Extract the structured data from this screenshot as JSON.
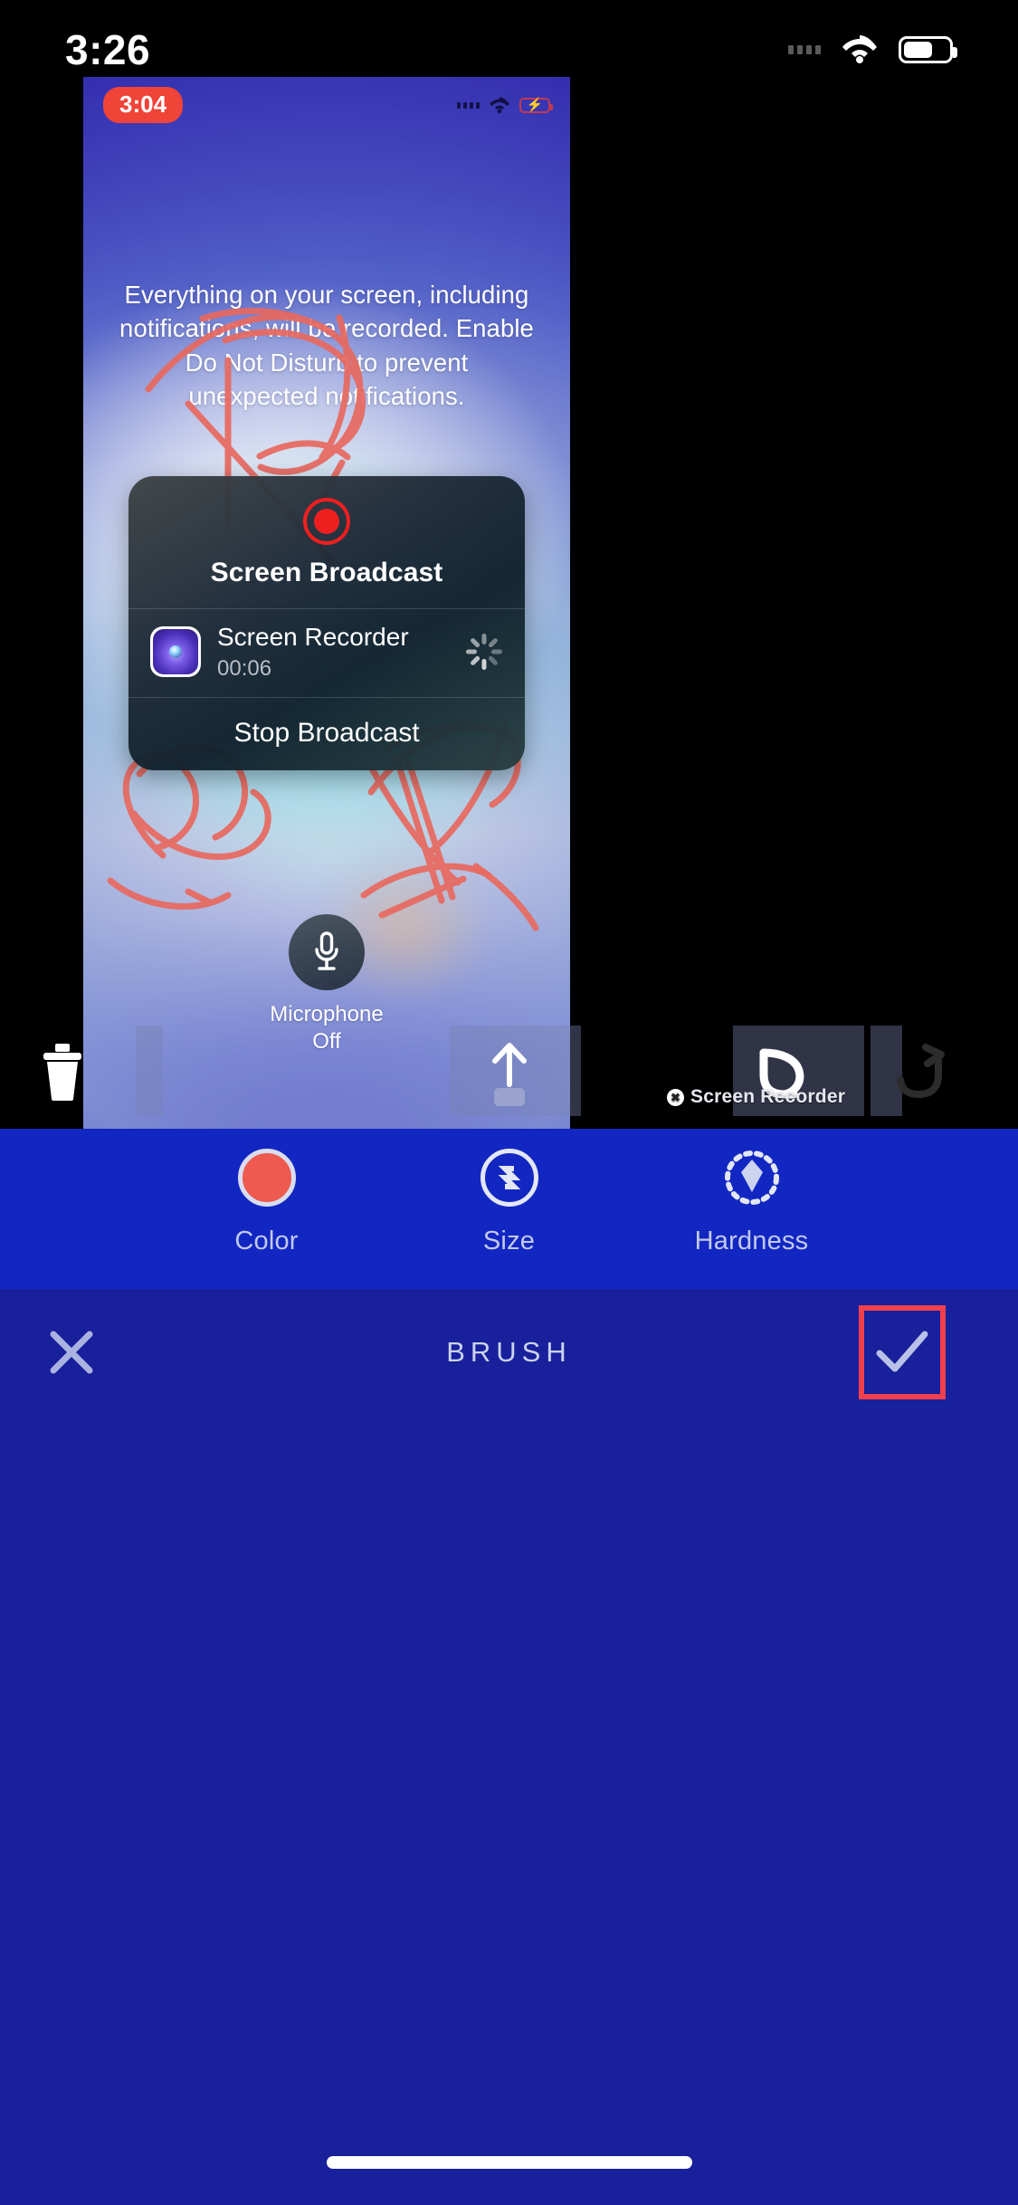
{
  "device_status_bar": {
    "time": "3:26",
    "icons": [
      "signal-dots-icon",
      "wifi-icon",
      "battery-icon"
    ]
  },
  "canvas": {
    "inner_status_bar": {
      "recording_pill_time": "3:04",
      "icons": [
        "signal-dots-icon",
        "wifi-icon",
        "battery-charging-icon"
      ]
    },
    "instruction_text": "Everything on your screen, including notifications, will be recorded. Enable Do Not Disturb to prevent unexpected notifications.",
    "broadcast_dialog": {
      "record_icon": "record-dot-icon",
      "title": "Screen Broadcast",
      "app_icon": "screen-recorder-app-icon",
      "app_name": "Screen Recorder",
      "elapsed": "00:06",
      "status_icon": "loading-spinner-icon",
      "stop_label": "Stop Broadcast"
    },
    "microphone": {
      "icon": "microphone-icon",
      "label_line1": "Microphone",
      "label_line2": "Off"
    },
    "watermark": {
      "badge": "✖",
      "text": "Screen Recorder"
    }
  },
  "edit_toolbar": {
    "items": [
      {
        "name": "delete-button",
        "icon": "trash-icon",
        "state": "enabled"
      },
      {
        "name": "share-button",
        "icon": "upload-icon",
        "state": "enabled"
      },
      {
        "name": "undo-button",
        "icon": "undo-icon",
        "state": "enabled"
      },
      {
        "name": "redo-button",
        "icon": "redo-icon",
        "state": "disabled"
      }
    ]
  },
  "brush_options": {
    "items": [
      {
        "label": "Color",
        "icon": "color-swatch-icon",
        "value": "#ee5a4f"
      },
      {
        "label": "Size",
        "icon": "brush-size-icon",
        "value": ""
      },
      {
        "label": "Hardness",
        "icon": "brush-hardness-icon",
        "value": ""
      }
    ]
  },
  "bottom_bar": {
    "cancel_icon": "close-x-icon",
    "title": "BRUSH",
    "confirm_icon": "checkmark-icon",
    "highlight_color": "#f2404d"
  },
  "colors": {
    "panel_blue": "#1227c2",
    "bar_blue": "#18209c",
    "accent_red": "#f2404d",
    "brush_red": "#ee5a4f",
    "record_red": "#f01f1f",
    "pill_red": "#f04438"
  }
}
